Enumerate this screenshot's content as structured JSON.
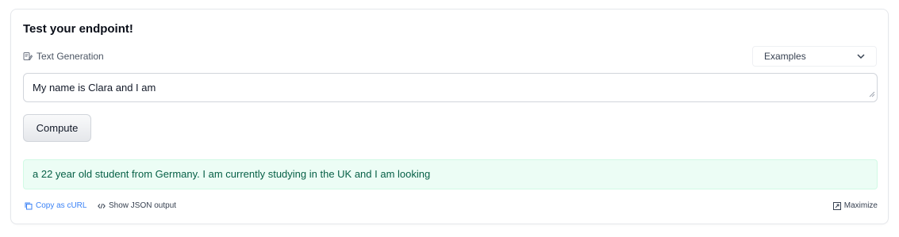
{
  "widget": {
    "title": "Test your endpoint!",
    "task_label": "Text Generation",
    "task_icon": "text-generation-icon",
    "examples_label": "Examples",
    "input_value": "My name is Clara and I am",
    "compute_label": "Compute",
    "output_text": "a 22 year old student from Germany. I am currently studying in the UK and I am looking",
    "copy_curl_label": "Copy as cURL",
    "show_json_label": "Show JSON output",
    "maximize_label": "Maximize"
  },
  "colors": {
    "output_bg": "#ecfdf5",
    "output_text": "#065f46",
    "link_blue": "#3b82f6"
  }
}
